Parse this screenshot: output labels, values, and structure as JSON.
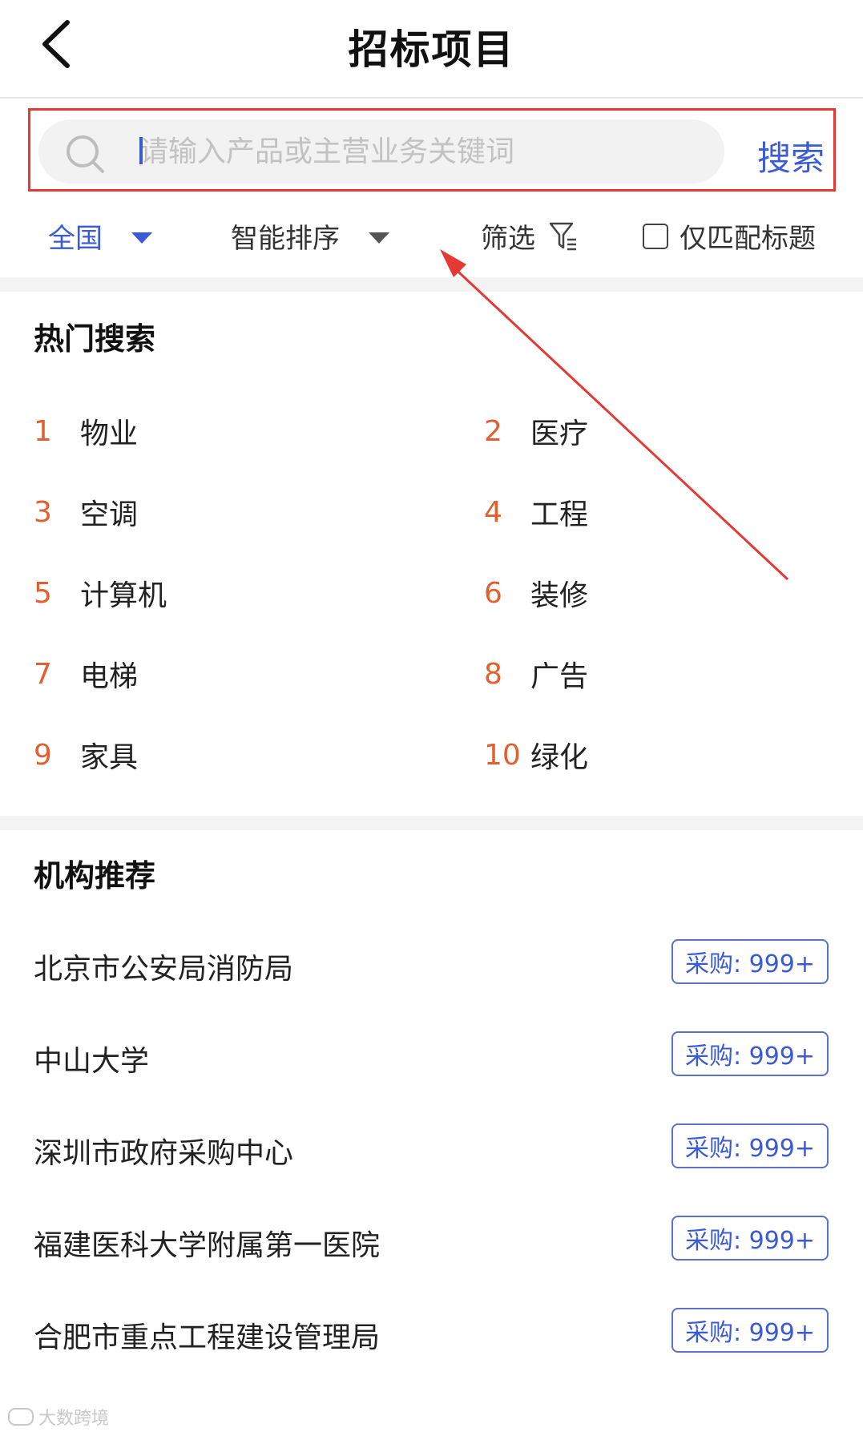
{
  "header": {
    "title": "招标项目"
  },
  "search": {
    "placeholder": "请输入产品或主营业务关键词",
    "button_label": "搜索"
  },
  "filters": {
    "region": "全国",
    "sort": "智能排序",
    "screen": "筛选",
    "match_title_label": "仅匹配标题",
    "match_title_checked": false
  },
  "hot_search": {
    "title": "热门搜索",
    "items": [
      {
        "rank": "1",
        "label": "物业"
      },
      {
        "rank": "2",
        "label": "医疗"
      },
      {
        "rank": "3",
        "label": "空调"
      },
      {
        "rank": "4",
        "label": "工程"
      },
      {
        "rank": "5",
        "label": "计算机"
      },
      {
        "rank": "6",
        "label": "装修"
      },
      {
        "rank": "7",
        "label": "电梯"
      },
      {
        "rank": "8",
        "label": "广告"
      },
      {
        "rank": "9",
        "label": "家具"
      },
      {
        "rank": "10",
        "label": "绿化"
      }
    ]
  },
  "org_recommend": {
    "title": "机构推荐",
    "items": [
      {
        "name": "北京市公安局消防局",
        "badge": "采购: 999+"
      },
      {
        "name": "中山大学",
        "badge": "采购: 999+"
      },
      {
        "name": "深圳市政府采购中心",
        "badge": "采购: 999+"
      },
      {
        "name": "福建医科大学附属第一医院",
        "badge": "采购: 999+"
      },
      {
        "name": "合肥市重点工程建设管理局",
        "badge": "采购: 999+"
      }
    ]
  },
  "colors": {
    "accent": "#3b5bd6",
    "rank": "#e0612f",
    "highlight": "#e53935"
  },
  "watermark": "大数跨境"
}
